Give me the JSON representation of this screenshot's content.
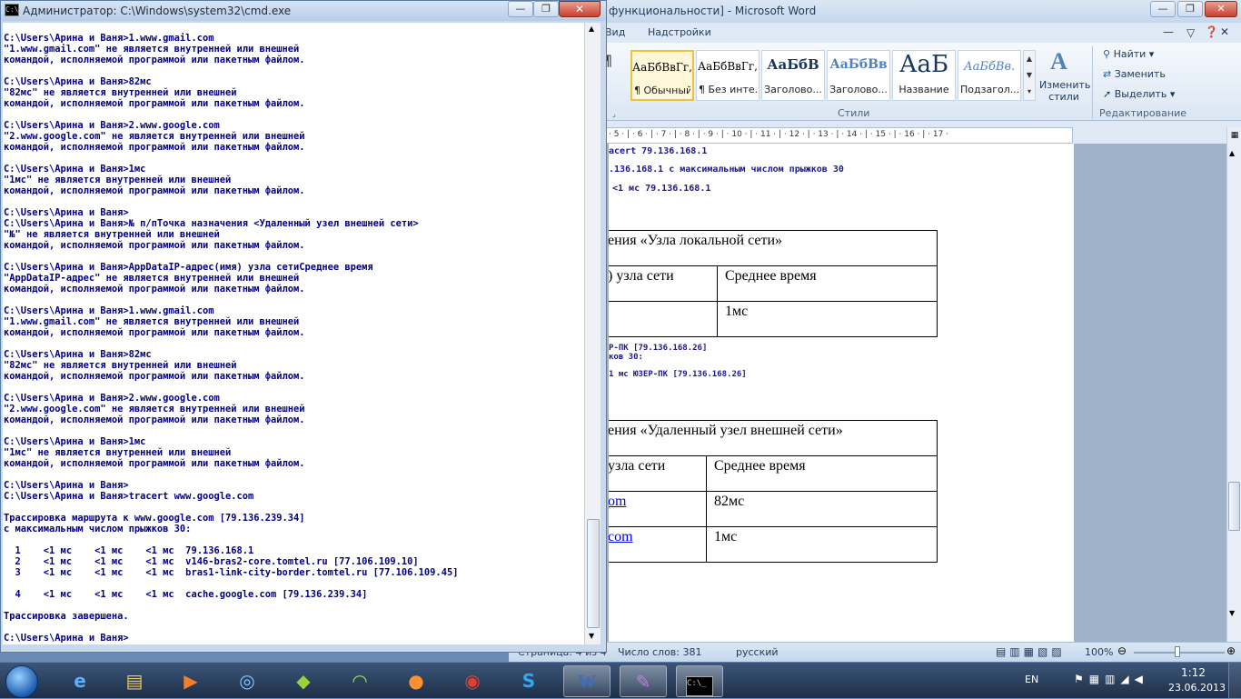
{
  "cmd": {
    "title": "Администратор: C:\\Windows\\system32\\cmd.exe",
    "lines": [
      "C:\\Users\\Арина и Ваня>1.www.gmail.com",
      "\"1.www.gmail.com\" не является внутренней или внешней",
      "командой, исполняемой программой или пакетным файлом.",
      "",
      "C:\\Users\\Арина и Ваня>82мс",
      "\"82мс\" не является внутренней или внешней",
      "командой, исполняемой программой или пакетным файлом.",
      "",
      "C:\\Users\\Арина и Ваня>2.www.google.com",
      "\"2.www.google.com\" не является внутренней или внешней",
      "командой, исполняемой программой или пакетным файлом.",
      "",
      "C:\\Users\\Арина и Ваня>1мс",
      "\"1мс\" не является внутренней или внешней",
      "командой, исполняемой программой или пакетным файлом.",
      "",
      "C:\\Users\\Арина и Ваня>",
      "C:\\Users\\Арина и Ваня>№ п/пТочка назначения <Удаленный узел внешней сети>",
      "\"№\" не является внутренней или внешней",
      "командой, исполняемой программой или пакетным файлом.",
      "",
      "C:\\Users\\Арина и Ваня>AppDataIP-адрес(имя) узла сетиСреднее время",
      "\"AppDataIP-адрес\" не является внутренней или внешней",
      "командой, исполняемой программой или пакетным файлом.",
      "",
      "C:\\Users\\Арина и Ваня>1.www.gmail.com",
      "\"1.www.gmail.com\" не является внутренней или внешней",
      "командой, исполняемой программой или пакетным файлом.",
      "",
      "C:\\Users\\Арина и Ваня>82мс",
      "\"82мс\" не является внутренней или внешней",
      "командой, исполняемой программой или пакетным файлом.",
      "",
      "C:\\Users\\Арина и Ваня>2.www.google.com",
      "\"2.www.google.com\" не является внутренней или внешней",
      "командой, исполняемой программой или пакетным файлом.",
      "",
      "C:\\Users\\Арина и Ваня>1мс",
      "\"1мс\" не является внутренней или внешней",
      "командой, исполняемой программой или пакетным файлом.",
      "",
      "C:\\Users\\Арина и Ваня>",
      "C:\\Users\\Арина и Ваня>tracert www.google.com",
      "",
      "Трассировка маршрута к www.google.com [79.136.239.34]",
      "с максимальным числом прыжков 30:",
      "",
      "  1    <1 мс    <1 мс    <1 мс  79.136.168.1",
      "  2    <1 мс    <1 мс    <1 мс  v146-bras2-core.tomtel.ru [77.106.109.10]",
      "  3    <1 мс    <1 мс    <1 мс  bras1-link-city-border.tomtel.ru [77.106.109.45]",
      "",
      "  4    <1 мс    <1 мс    <1 мс  cache.google.com [79.136.239.34]",
      "",
      "Трассировка завершена.",
      "",
      "C:\\Users\\Арина и Ваня>"
    ]
  },
  "word": {
    "title": "функциональности] - Microsoft Word",
    "tabs": [
      "Вид",
      "Надстройки"
    ],
    "styles": [
      {
        "sample": "АаБбВвГг,",
        "name": "¶ Обычный"
      },
      {
        "sample": "АаБбВвГг,",
        "name": "¶ Без инте..."
      },
      {
        "sample": "АаБбВ",
        "name": "Заголово..."
      },
      {
        "sample": "АаБбВв",
        "name": "Заголово..."
      },
      {
        "sample": "АаБ",
        "name": "Название"
      },
      {
        "sample": "АаБбВв.",
        "name": "Подзагол..."
      }
    ],
    "change_styles": "Изменить стили",
    "styles_group": "Стили",
    "edit_group": "Редактирование",
    "find": "Найти",
    "replace": "Заменить",
    "select": "Выделить",
    "ruler": "· 5 · | · 6 · | · 7 · | · 8 · | · 9 · | · 10 · | · 11 · | · 12 · | · 13 · | · 14 · | · 15 · | · 16 · | · 17 ·",
    "doc": {
      "line1": "acert 79.136.168.1",
      "line2": ".136.168.1 с максимальным числом прыжков 30",
      "line3": "<1 мс  79.136.168.1",
      "table1_header": "ения «Узла локальной сети»",
      "table1_col1": ") узла сети",
      "table1_col2": "Среднее время",
      "table1_val": "1мс",
      "line4": "Р-ПК [79.136.168.26]",
      "line5": "ков 30:",
      "line6": "1 мс  ЮЗЕР-ПК [79.136.168.26]",
      "table2_header": "ения «Удаленный узел внешней сети»",
      "table2_col1": " узла сети",
      "table2_col2": "Среднее время",
      "table2_r1_link": "om",
      "table2_r1_val": "82мс",
      "table2_r2_link": "com",
      "table2_r2_val": "1мс"
    },
    "status": {
      "page": "Страница: 4 из 4",
      "words": "Число слов: 381",
      "lang": "русский",
      "zoom": "100%"
    }
  },
  "taskbar": {
    "lang": "EN",
    "time": "1:12",
    "date": "23.06.2013"
  }
}
